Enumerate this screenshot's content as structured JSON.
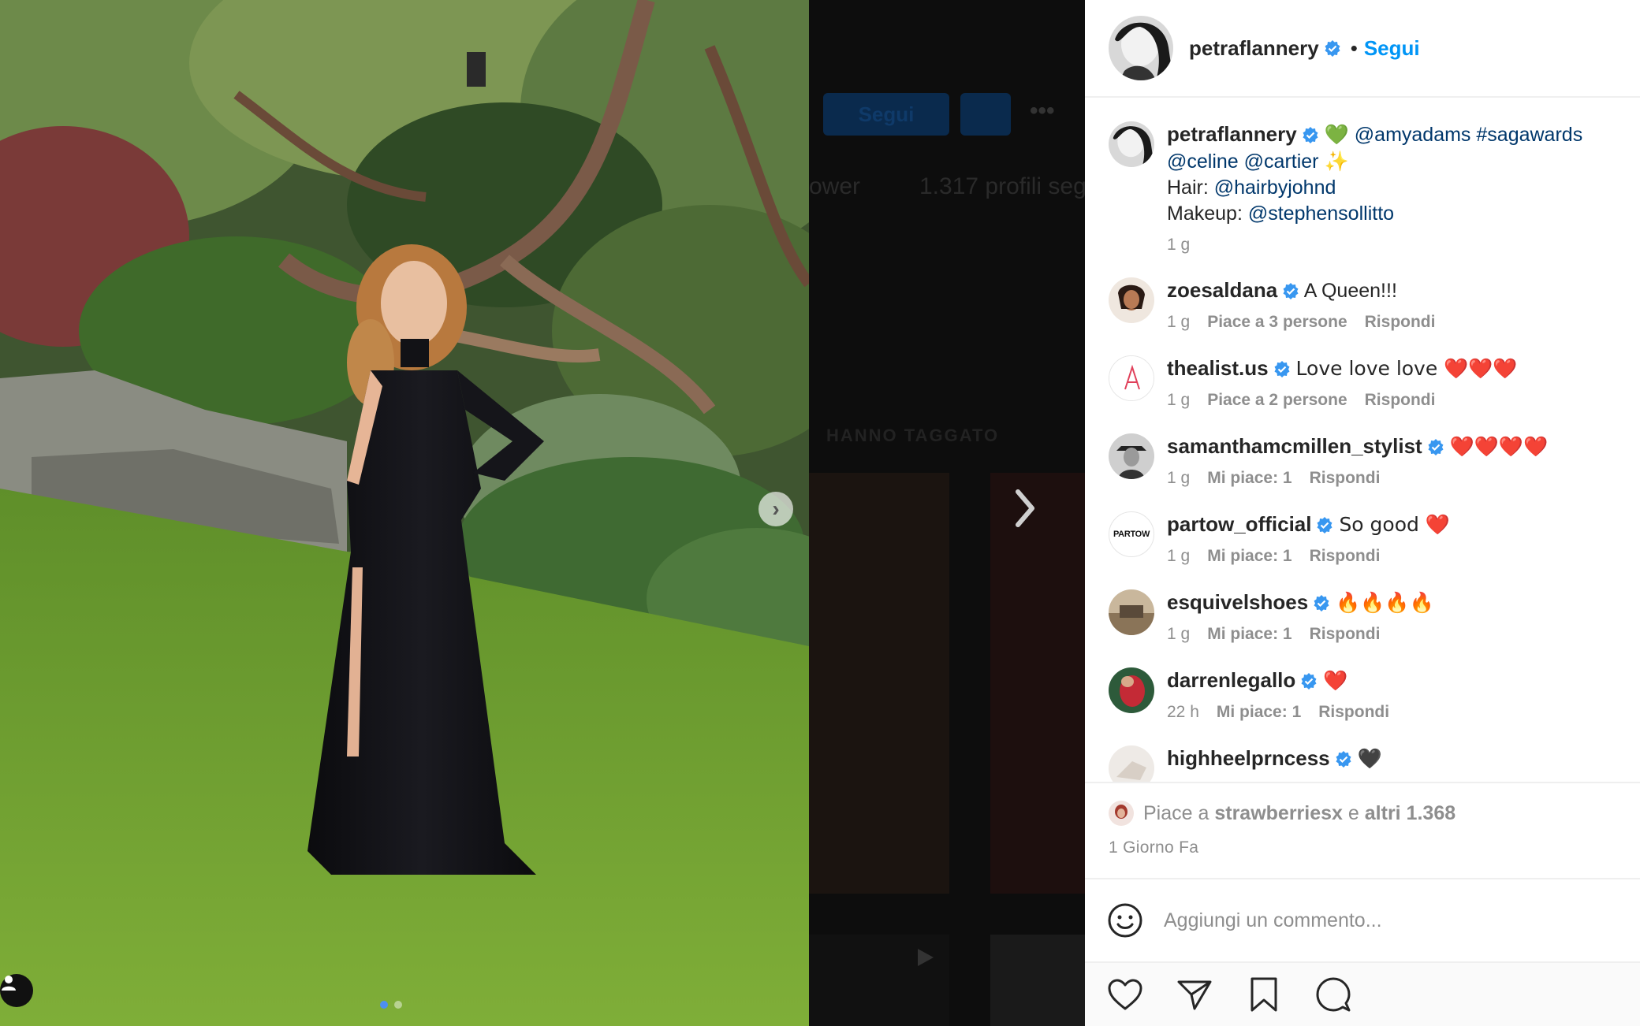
{
  "background_page": {
    "follow_label": "Segui",
    "followers_fragment": "ower",
    "following_fragment": "1.317 profili seg",
    "tagged_label": "HANNO TAGGATO",
    "more_label": "•••"
  },
  "post": {
    "carousel_dots": 2,
    "active_dot": 0
  },
  "header": {
    "username": "petraflannery",
    "separator": "•",
    "follow_label": "Segui"
  },
  "caption": {
    "username": "petraflannery",
    "emoji_1": "💚",
    "mention_1": "@amyadams",
    "hashtag": "#sagawards",
    "mention_2": "@celine",
    "mention_3": "@cartier",
    "emoji_2": "✨",
    "hair_label": "Hair:",
    "hair_mention": "@hairbyjohnd",
    "makeup_label": "Makeup:",
    "makeup_mention": "@stephensollitto",
    "time": "1 g"
  },
  "comments": [
    {
      "username": "zoesaldana",
      "text": "A Queen!!!",
      "time": "1 g",
      "likes": "Piace a 3 persone",
      "reply": "Rispondi"
    },
    {
      "username": "thealist.us",
      "text": "Love love love ❤️❤️❤️",
      "time": "1 g",
      "likes": "Piace a 2 persone",
      "reply": "Rispondi"
    },
    {
      "username": "samanthamcmillen_stylist",
      "text": "❤️❤️❤️❤️",
      "time": "1 g",
      "likes": "Mi piace: 1",
      "reply": "Rispondi"
    },
    {
      "username": "partow_official",
      "text": "So good ❤️",
      "time": "1 g",
      "likes": "Mi piace: 1",
      "reply": "Rispondi",
      "avatar_text": "PARTOW"
    },
    {
      "username": "esquivelshoes",
      "text": "🔥🔥🔥🔥",
      "time": "1 g",
      "likes": "Mi piace: 1",
      "reply": "Rispondi"
    },
    {
      "username": "darrenlegallo",
      "text": "❤️",
      "time": "22 h",
      "likes": "Mi piace: 1",
      "reply": "Rispondi"
    },
    {
      "username": "highheelprncess",
      "text": "🖤"
    }
  ],
  "likes": {
    "prefix": "Piace a",
    "user": "strawberriesx",
    "middle": "e",
    "others": "altri 1.368",
    "time_ago": "1 Giorno Fa"
  },
  "comment_box": {
    "placeholder": "Aggiungi un commento..."
  },
  "icons": {
    "like": "heart-icon",
    "share": "paper-plane-icon",
    "save": "bookmark-icon",
    "comment": "speech-bubble-icon",
    "emoji": "smiley-icon"
  },
  "colors": {
    "link": "#0095f6",
    "mention": "#00376b",
    "verified": "#3897f0",
    "muted": "#8e8e8e"
  }
}
